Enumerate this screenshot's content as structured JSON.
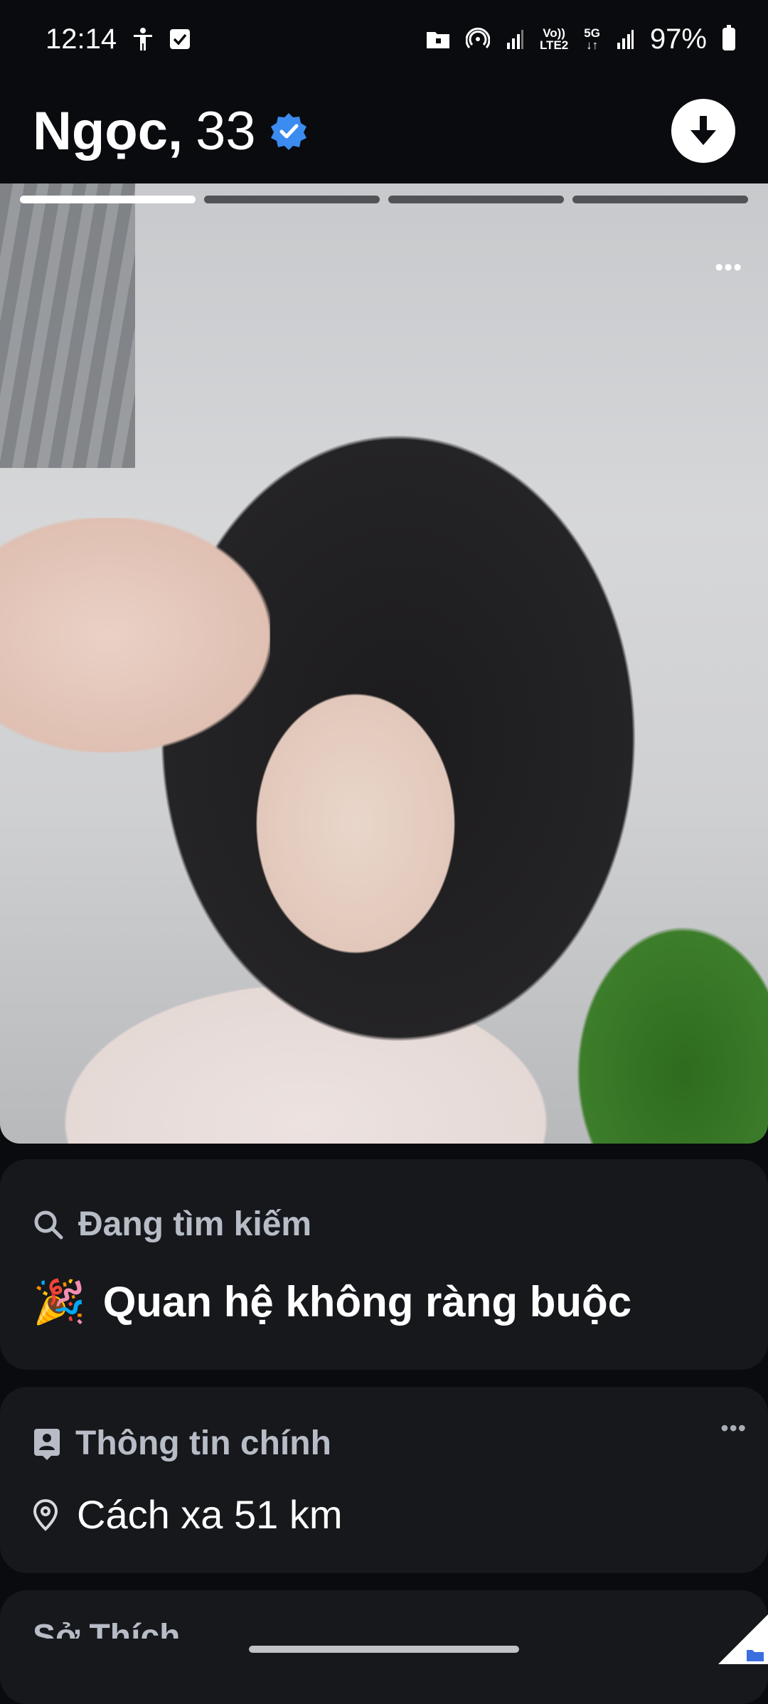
{
  "status_bar": {
    "time": "12:14",
    "network_top": "Vo))",
    "network_bottom": "LTE2",
    "fiveg": "5G",
    "battery": "97%"
  },
  "profile": {
    "name": "Ngọc,",
    "age": "33",
    "verified": true,
    "photo_count": 4,
    "current_photo": 1
  },
  "looking_for": {
    "title": "Đang tìm kiếm",
    "emoji": "🎉",
    "value": "Quan hệ không ràng buộc"
  },
  "main_info": {
    "title": "Thông tin chính",
    "distance": "Cách xa 51 km"
  },
  "next_section": {
    "title": "Sở Thích"
  },
  "colors": {
    "background": "#0a0b0e",
    "card": "#16181c",
    "verified": "#3b8bf0",
    "muted_text": "#b7bcc6"
  }
}
